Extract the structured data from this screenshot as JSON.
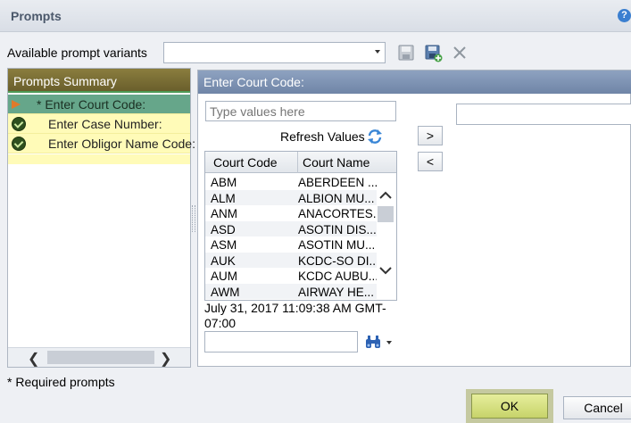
{
  "window": {
    "title": "Prompts",
    "help_glyph": "?"
  },
  "variants": {
    "label": "Available prompt variants",
    "value": ""
  },
  "summary": {
    "header": "Prompts Summary",
    "items": [
      {
        "label": "* Enter Court Code:",
        "icon": "arrow-icon",
        "active": true
      },
      {
        "label": "Enter Case Number:",
        "icon": "check-icon",
        "active": false
      },
      {
        "label": "Enter Obligor Name Code:",
        "icon": "check-icon",
        "active": false
      }
    ]
  },
  "court": {
    "header": "Enter Court Code:",
    "search_placeholder": "Type values here",
    "refresh_label": "Refresh Values",
    "add_label": ">",
    "remove_label": "<",
    "columns": [
      "Court Code",
      "Court Name"
    ],
    "rows": [
      [
        "ABM",
        "ABERDEEN ..."
      ],
      [
        "ALM",
        "ALBION MU..."
      ],
      [
        "ANM",
        "ANACORTES..."
      ],
      [
        "ASD",
        "ASOTIN DIS..."
      ],
      [
        "ASM",
        "ASOTIN MU..."
      ],
      [
        "AUK",
        "KCDC-SO DI..."
      ],
      [
        "AUM",
        "KCDC AUBU..."
      ],
      [
        "AWM",
        "AIRWAY HE..."
      ]
    ],
    "timestamp": "July 31, 2017 11:09:38 AM GMT-07:00"
  },
  "footer": {
    "required_note": "* Required prompts",
    "ok_label": "OK",
    "cancel_label": "Cancel"
  },
  "colors": {
    "summary_header": "#7a6e35",
    "active_row": "#66a68a",
    "summary_row": "#fffbb8",
    "court_header": "#7e93b4",
    "ok_button": "#d6e07f"
  }
}
